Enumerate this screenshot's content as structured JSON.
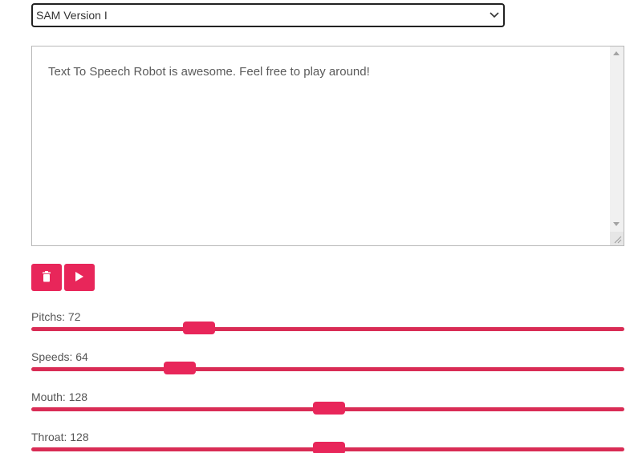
{
  "voice_select": {
    "selected": "SAM Version I"
  },
  "textarea": {
    "text": "Text To Speech Robot is awesome. Feel free to play around!"
  },
  "buttons": {
    "clear_icon": "trash-icon",
    "play_icon": "play-icon"
  },
  "colors": {
    "accent": "#e8265a",
    "rail": "#d92c55"
  },
  "sliders": [
    {
      "label": "Pitchs: 72",
      "value": 72,
      "min": 0,
      "max": 255
    },
    {
      "label": "Speeds: 64",
      "value": 64,
      "min": 0,
      "max": 255
    },
    {
      "label": "Mouth: 128",
      "value": 128,
      "min": 0,
      "max": 255
    },
    {
      "label": "Throat: 128",
      "value": 128,
      "min": 0,
      "max": 255
    }
  ]
}
